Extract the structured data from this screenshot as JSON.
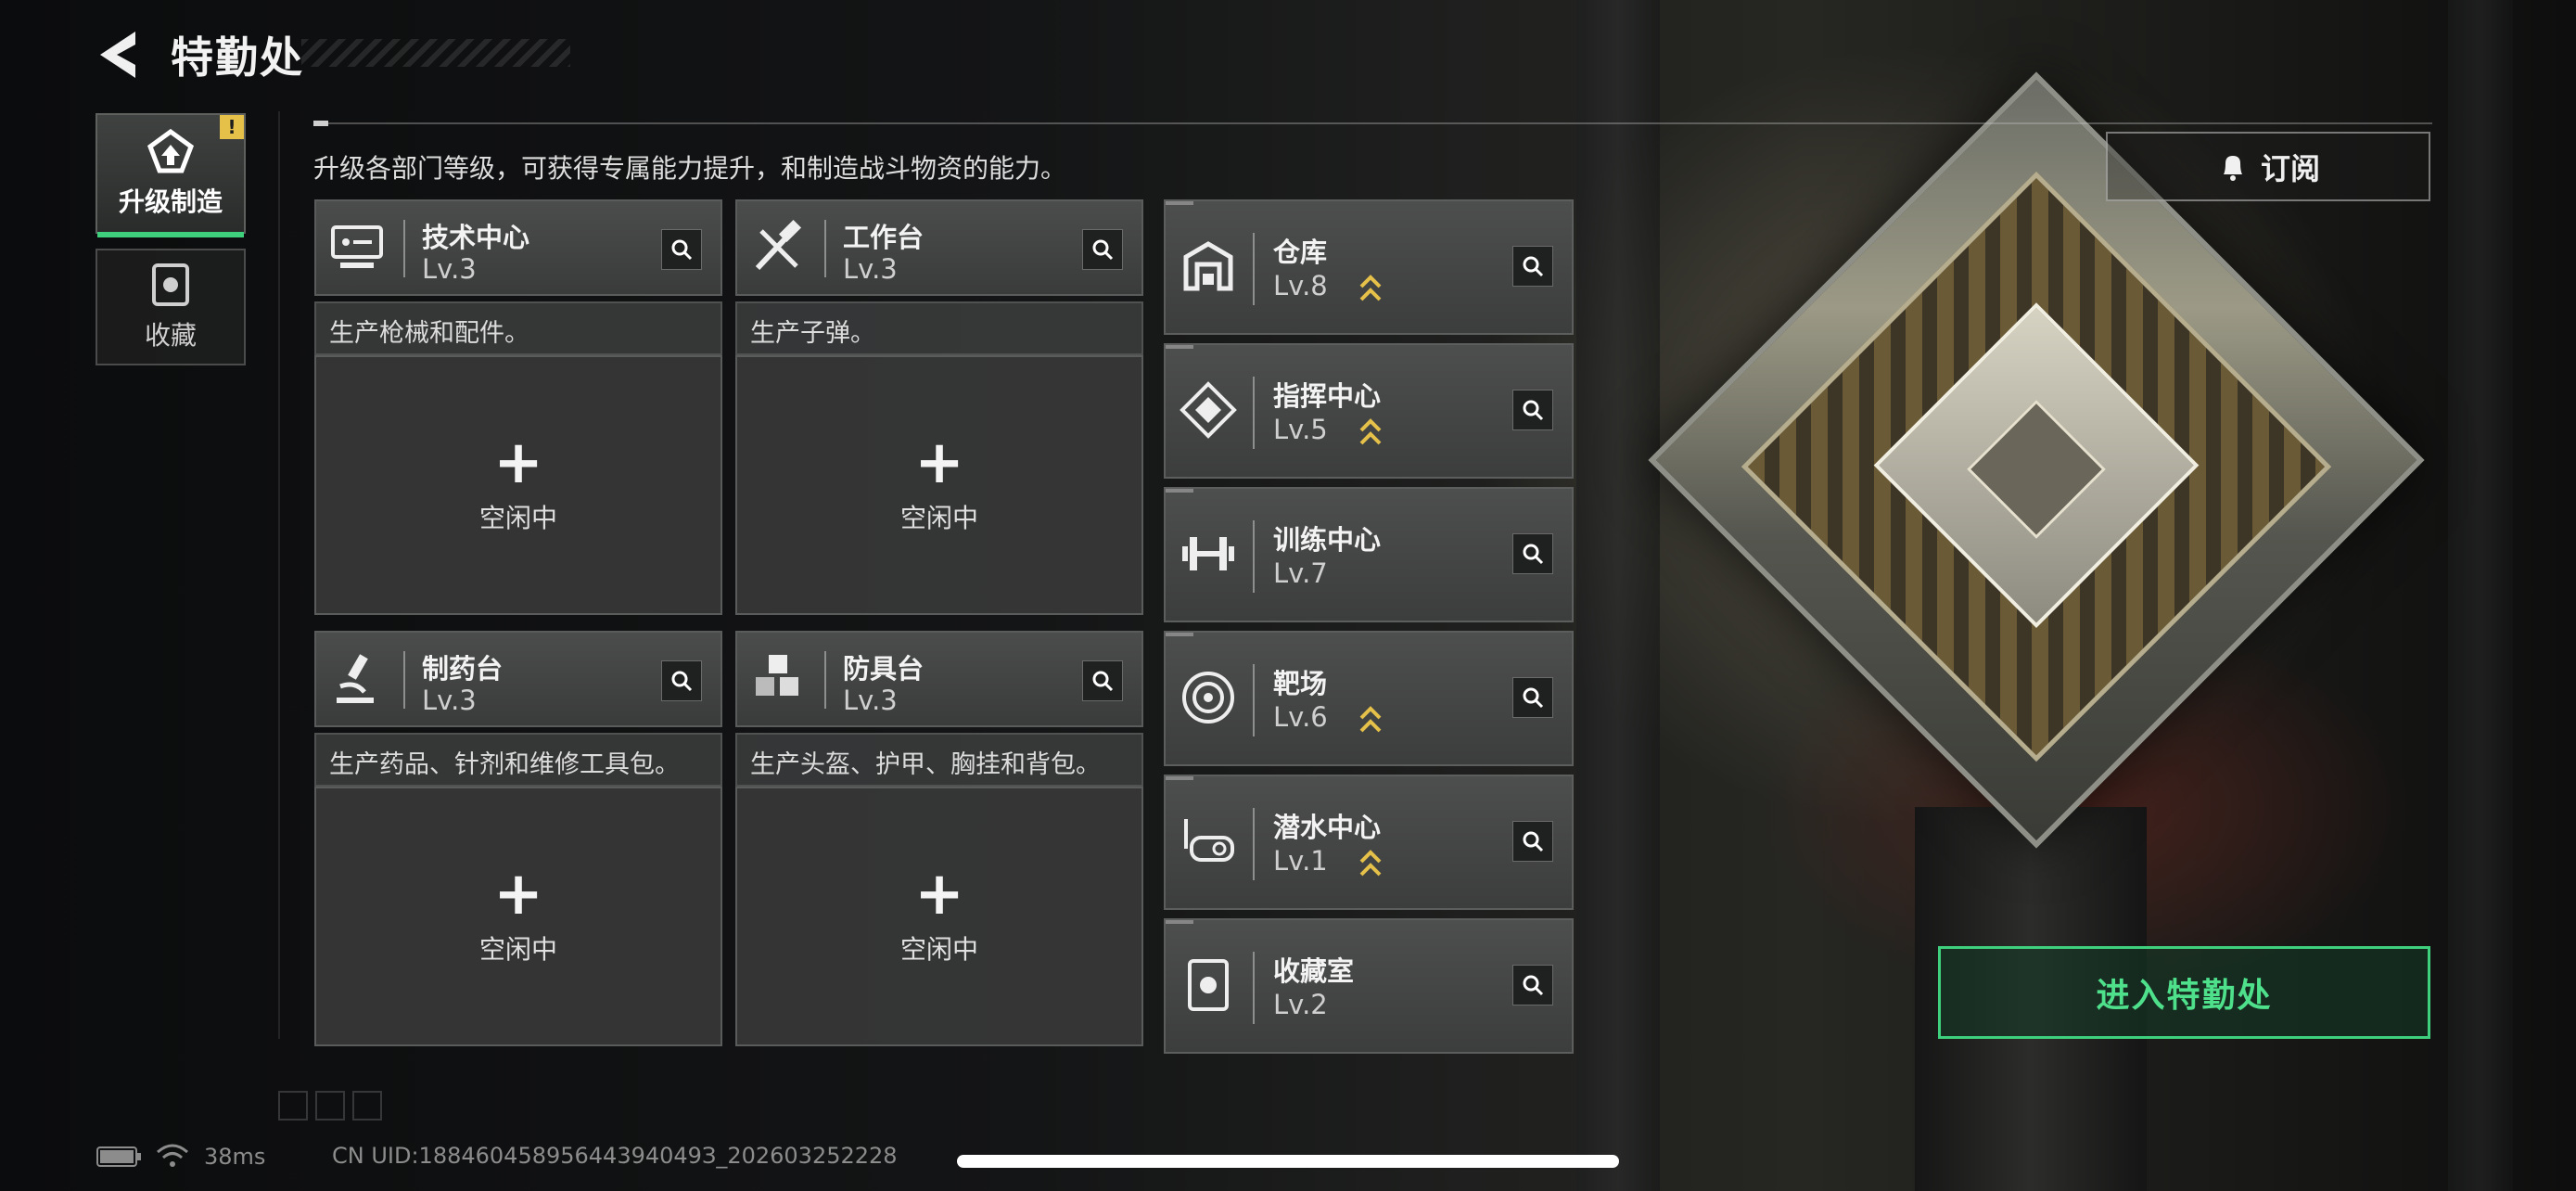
{
  "header": {
    "title": "特勤处"
  },
  "sidebar": {
    "tabs": [
      {
        "label": "升级制造",
        "badge": "!"
      },
      {
        "label": "收藏"
      }
    ]
  },
  "description": "升级各部门等级，可获得专属能力提升，和制造战斗物资的能力。",
  "stations": [
    {
      "name": "技术中心",
      "level": "Lv.3",
      "desc": "生产枪械和配件。",
      "slot": "空闲中",
      "icon": "computer-icon"
    },
    {
      "name": "工作台",
      "level": "Lv.3",
      "desc": "生产子弹。",
      "slot": "空闲中",
      "icon": "tools-icon"
    },
    {
      "name": "制药台",
      "level": "Lv.3",
      "desc": "生产药品、针剂和维修工具包。",
      "slot": "空闲中",
      "icon": "microscope-icon"
    },
    {
      "name": "防具台",
      "level": "Lv.3",
      "desc": "生产头盔、护甲、胸挂和背包。",
      "slot": "空闲中",
      "icon": "boxes-icon"
    }
  ],
  "facilities": [
    {
      "name": "仓库",
      "level": "Lv.8",
      "upgradable": true,
      "icon": "warehouse-icon"
    },
    {
      "name": "指挥中心",
      "level": "Lv.5",
      "upgradable": true,
      "icon": "command-icon"
    },
    {
      "name": "训练中心",
      "level": "Lv.7",
      "upgradable": false,
      "icon": "dumbbell-icon"
    },
    {
      "name": "靶场",
      "level": "Lv.6",
      "upgradable": true,
      "icon": "target-icon"
    },
    {
      "name": "潜水中心",
      "level": "Lv.1",
      "upgradable": true,
      "icon": "diving-mask-icon"
    },
    {
      "name": "收藏室",
      "level": "Lv.2",
      "upgradable": false,
      "icon": "collection-icon"
    }
  ],
  "subscribe": {
    "label": "订阅"
  },
  "enter_button": {
    "label": "进入特勤处"
  },
  "status": {
    "ping": "38ms",
    "uid": "CN UID:18846045895644394049З_202603252228"
  },
  "colors": {
    "accent": "#3ed07c",
    "upgrade": "#e6c14a"
  }
}
